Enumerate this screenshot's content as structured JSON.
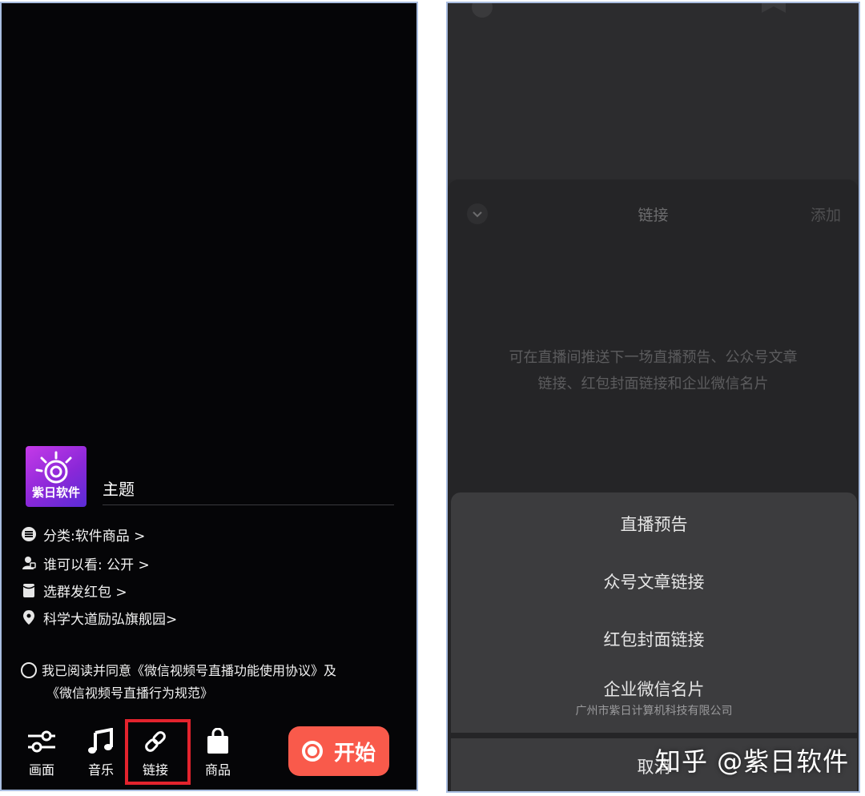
{
  "left": {
    "logo_text": "紫日软件",
    "topic_label": "主题",
    "category": "分类:软件商品 >",
    "visibility": "谁可以看: 公开 >",
    "red_packet": "选群发红包 >",
    "location": "科学大道励弘旗舰园>",
    "agreement_line1": "我已阅读并同意《微信视频号直播功能使用协议》及",
    "agreement_line2": "《微信视频号直播行为规范》",
    "tools": [
      {
        "label": "画面",
        "icon": "sliders-icon"
      },
      {
        "label": "音乐",
        "icon": "music-note-icon"
      },
      {
        "label": "链接",
        "icon": "link-icon"
      },
      {
        "label": "商品",
        "icon": "shopping-bag-icon"
      }
    ],
    "start_label": "开始",
    "accent_color": "#f95a4b",
    "highlight_color": "#e3232d"
  },
  "right": {
    "sheet_title": "链接",
    "sheet_action": "添加",
    "hint_line1": "可在直播间推送下一场直播预告、公众号文章",
    "hint_line2": "链接、红包封面链接和企业微信名片",
    "menu": [
      {
        "label": "直播预告"
      },
      {
        "label": "众号文章链接"
      },
      {
        "label": "红包封面链接"
      },
      {
        "label": "企业微信名片",
        "sub": "广州市紫日计算机科技有限公司"
      }
    ],
    "cancel_label": "取消"
  },
  "watermark": "知乎 @紫日软件"
}
